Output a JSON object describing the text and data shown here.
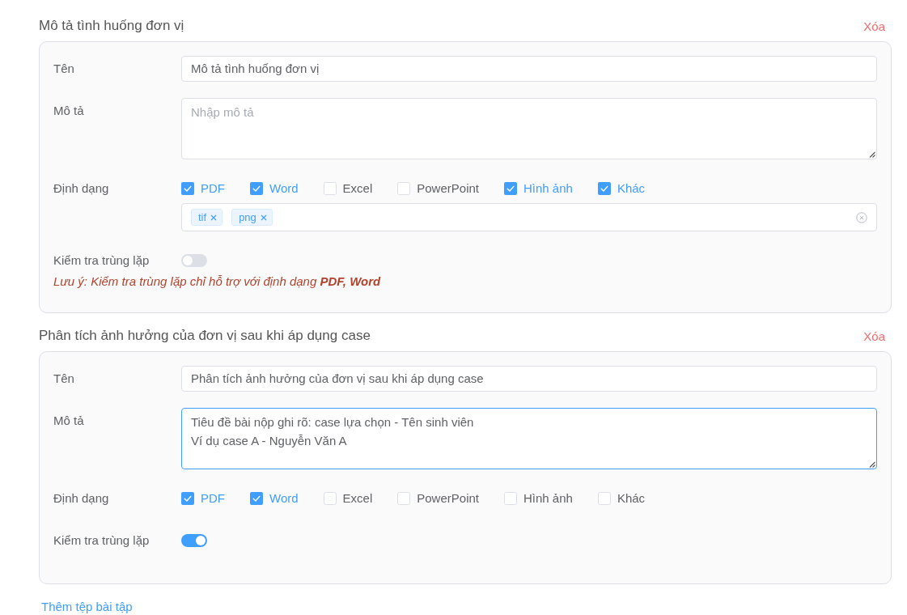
{
  "sections": [
    {
      "title": "Mô tả tình huống đơn vị",
      "delete_label": "Xóa",
      "fields": [
        {
          "kind": "input",
          "label": "Tên",
          "value": "Mô tả tình huống đơn vị"
        },
        {
          "kind": "textarea",
          "label": "Mô tả",
          "placeholder": "Nhập mô tả",
          "focused": false
        },
        {
          "kind": "formats",
          "label": "Định dạng",
          "options": [
            {
              "label": "PDF",
              "checked": true
            },
            {
              "label": "Word",
              "checked": true
            },
            {
              "label": "Excel",
              "checked": false
            },
            {
              "label": "PowerPoint",
              "checked": false
            },
            {
              "label": "Hình ảnh",
              "checked": true
            },
            {
              "label": "Khác",
              "checked": true
            }
          ],
          "tags": [
            {
              "label": "tif"
            },
            {
              "label": "png"
            }
          ]
        },
        {
          "kind": "toggle",
          "label": "Kiểm tra trùng lặp",
          "on": false,
          "note": "Lưu ý: Kiểm tra trùng lặp chỉ hỗ trợ với định dạng **PDF, Word**"
        }
      ]
    },
    {
      "title": "Phân tích ảnh hưởng của đơn vị sau khi áp dụng case",
      "delete_label": "Xóa",
      "fields": [
        {
          "kind": "input",
          "label": "Tên",
          "value": "Phân tích ảnh hưởng của đơn vị sau khi áp dụng case"
        },
        {
          "kind": "textarea",
          "label": "Mô tả",
          "value": "Tiêu đề bài nộp ghi rõ: case lựa chọn - Tên sinh viên\nVí dụ case A - Nguyễn Văn A",
          "focused": true
        },
        {
          "kind": "formats",
          "label": "Định dạng",
          "options": [
            {
              "label": "PDF",
              "checked": true
            },
            {
              "label": "Word",
              "checked": true
            },
            {
              "label": "Excel",
              "checked": false
            },
            {
              "label": "PowerPoint",
              "checked": false
            },
            {
              "label": "Hình ảnh",
              "checked": false
            },
            {
              "label": "Khác",
              "checked": false
            }
          ]
        },
        {
          "kind": "toggle",
          "label": "Kiểm tra trùng lặp",
          "on": true
        }
      ]
    }
  ],
  "add_link": "Thêm tệp bài tập"
}
